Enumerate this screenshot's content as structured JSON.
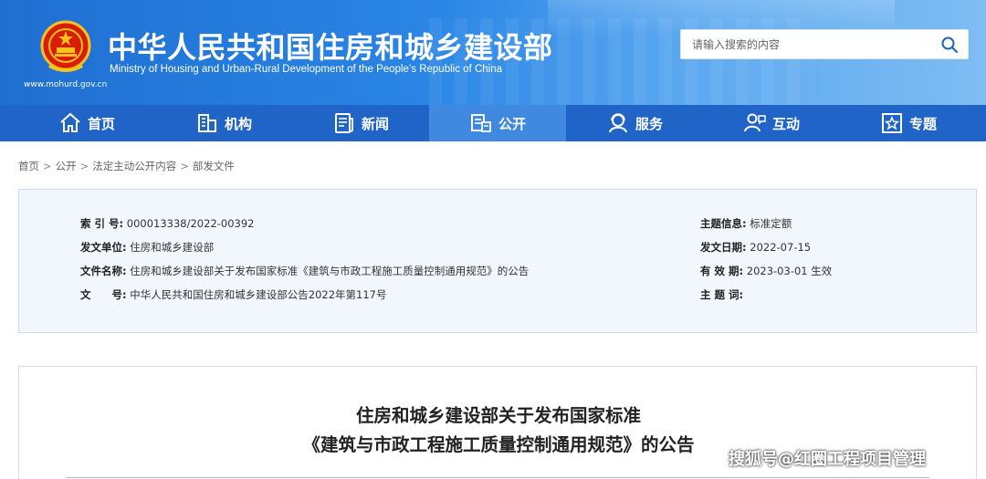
{
  "header": {
    "site_title": "中华人民共和国住房和城乡建设部",
    "site_subtitle": "Ministry of Housing and Urban-Rural Development of the People’s Republic of China",
    "site_url": "www.mohurd.gov.cn",
    "emblem_icon": "national-emblem",
    "search": {
      "placeholder": "请输入搜索的内容",
      "icon": "search-icon"
    }
  },
  "nav": {
    "items": [
      {
        "label": "首页",
        "icon": "home-icon"
      },
      {
        "label": "机构",
        "icon": "building-icon"
      },
      {
        "label": "新闻",
        "icon": "newspaper-icon"
      },
      {
        "label": "公开",
        "icon": "document-open-icon",
        "active": true
      },
      {
        "label": "服务",
        "icon": "service-icon"
      },
      {
        "label": "互动",
        "icon": "interaction-icon"
      },
      {
        "label": "专题",
        "icon": "star-icon"
      }
    ]
  },
  "breadcrumb": [
    "首页",
    "公开",
    "法定主动公开内容",
    "部发文件"
  ],
  "info": {
    "index_label": "索 引 号:",
    "index_value": "000013338/2022-00392",
    "issuer_label": "发文单位:",
    "issuer_value": "住房和城乡建设部",
    "filename_label": "文件名称:",
    "filename_value": "住房和城乡建设部关于发布国家标准《建筑与市政工程施工质量控制通用规范》的公告",
    "docno_label": "文　　号:",
    "docno_value": "中华人民共和国住房和城乡建设部公告2022年第117号",
    "topic_label": "主题信息:",
    "topic_value": "标准定额",
    "date_label": "发文日期:",
    "date_value": "2022-07-15",
    "valid_label": "有 效 期:",
    "valid_value": "2023-03-01 生效",
    "keywords_label": "主 题 词:",
    "keywords_value": ""
  },
  "article": {
    "title_line1": "住房和城乡建设部关于发布国家标准",
    "title_line2": "《建筑与市政工程施工质量控制通用规范》的公告"
  },
  "watermark": "搜狐号@红圈工程项目管理",
  "colors": {
    "nav_bg": "#1f64c6",
    "nav_active": "#3f8ae0",
    "header_start": "#1f6fd1",
    "info_bg": "#f1f7fd"
  }
}
